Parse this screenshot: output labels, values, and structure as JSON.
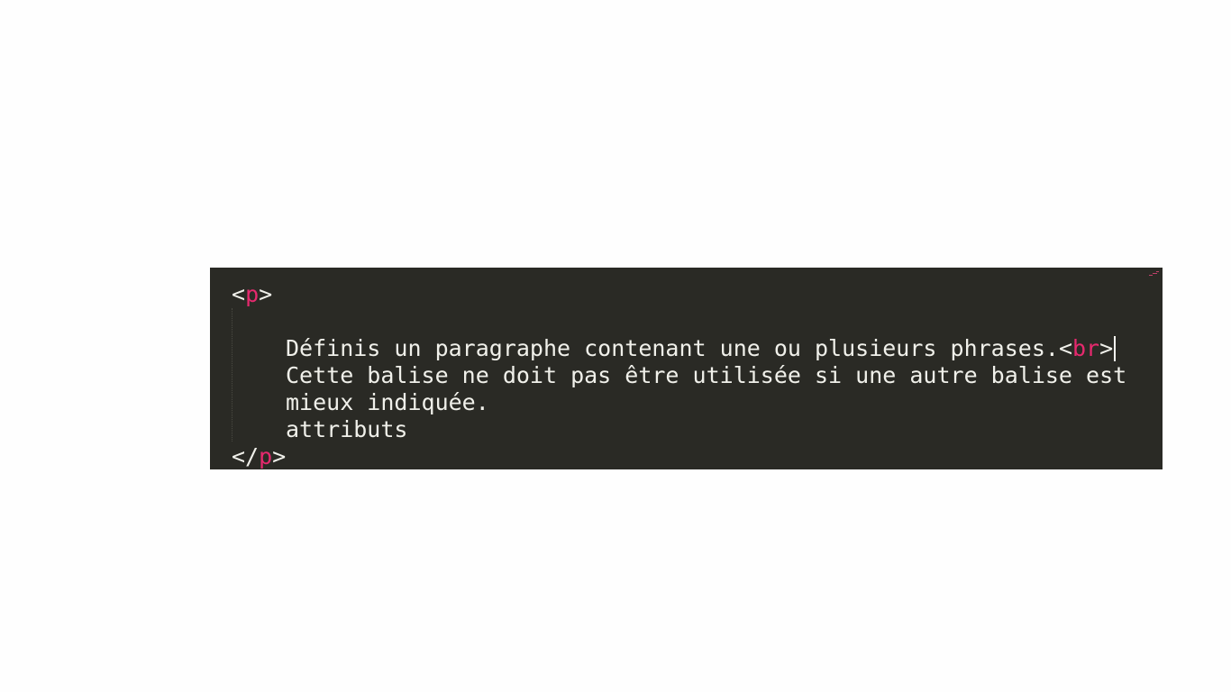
{
  "editor": {
    "line1": {
      "open": "<",
      "tag": "p",
      "close": ">"
    },
    "line3": {
      "text": "Définis un paragraphe contenant une ou plusieurs phrases.",
      "tag_open": "<",
      "tag": "br",
      "tag_close": ">"
    },
    "line4": {
      "text": "Cette balise ne doit pas être utilisée si une autre balise est"
    },
    "line5": {
      "text": "mieux indiquée."
    },
    "line6": {
      "text": "attributs"
    },
    "line7": {
      "open": "</",
      "tag": "p",
      "close": ">"
    },
    "colors": {
      "background": "#2a2a25",
      "text": "#f0f0ea",
      "tag": "#e6296e"
    }
  }
}
